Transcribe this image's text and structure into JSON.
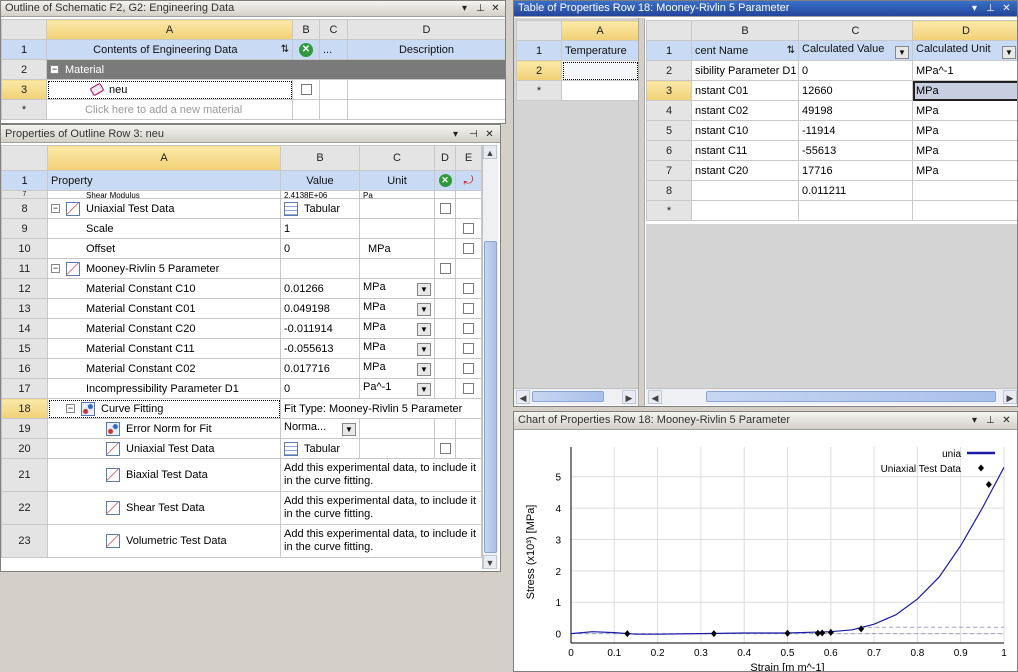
{
  "outline": {
    "title": "Outline of Schematic F2, G2: Engineering Data",
    "cols": [
      "A",
      "B",
      "C",
      "D"
    ],
    "hdr": {
      "rn": "1",
      "a": "Contents of Engineering Data",
      "c": "\u0015...",
      "d": "Description"
    },
    "rows": [
      {
        "rn": "2",
        "a": "Material"
      },
      {
        "rn": "3",
        "a": "neu"
      },
      {
        "rn": "*",
        "a": "Click here to add a new material"
      }
    ]
  },
  "props": {
    "title": "Properties of Outline Row 3: neu",
    "cols": [
      "A",
      "B",
      "C",
      "D",
      "E"
    ],
    "hdr": {
      "rn": "1",
      "a": "Property",
      "b": "Value",
      "c": "Unit"
    },
    "rows": [
      {
        "rn": "7",
        "a": "Shear Modulus",
        "b": "2.4138E+06",
        "c": "Pa"
      },
      {
        "rn": "8",
        "a": "Uniaxial Test Data",
        "b": "Tabular",
        "c": ""
      },
      {
        "rn": "9",
        "a": "Scale",
        "b": "1",
        "c": ""
      },
      {
        "rn": "10",
        "a": "Offset",
        "b": "0",
        "c": "MPa"
      },
      {
        "rn": "11",
        "a": "Mooney-Rivlin 5 Parameter",
        "b": "",
        "c": ""
      },
      {
        "rn": "12",
        "a": "Material Constant C10",
        "b": "0.01266",
        "c": "MPa"
      },
      {
        "rn": "13",
        "a": "Material Constant C01",
        "b": "0.049198",
        "c": "MPa"
      },
      {
        "rn": "14",
        "a": "Material Constant C20",
        "b": "-0.011914",
        "c": "MPa"
      },
      {
        "rn": "15",
        "a": "Material Constant C11",
        "b": "-0.055613",
        "c": "MPa"
      },
      {
        "rn": "16",
        "a": "Material Constant C02",
        "b": "0.017716",
        "c": "MPa"
      },
      {
        "rn": "17",
        "a": "Incompressibility Parameter D1",
        "b": "0",
        "c": "Pa^-1"
      },
      {
        "rn": "18",
        "a": "Curve Fitting",
        "b": "Fit Type: Mooney-Rivlin 5 Parameter",
        "c": ""
      },
      {
        "rn": "19",
        "a": "Error Norm for Fit",
        "b": "Norma...",
        "c": ""
      },
      {
        "rn": "20",
        "a": "Uniaxial Test Data",
        "b": "Tabular",
        "c": ""
      },
      {
        "rn": "21",
        "a": "Biaxial Test Data",
        "b": "Add this experimental data, to include it in the curve fitting.",
        "c": ""
      },
      {
        "rn": "22",
        "a": "Shear Test Data",
        "b": "Add this experimental data, to include it in the curve fitting.",
        "c": ""
      },
      {
        "rn": "23",
        "a": "Volumetric Test Data",
        "b": "Add this experimental data, to include it in the curve fitting.",
        "c": ""
      }
    ]
  },
  "table": {
    "title": "Table of Properties Row 18: Mooney-Rivlin 5 Parameter",
    "left_cols": [
      "A"
    ],
    "left_hdr": {
      "rn": "1",
      "a": "Temperature"
    },
    "left_rows": [
      "2",
      "*"
    ],
    "cols": [
      "B",
      "C",
      "D"
    ],
    "hdr": {
      "rn": "1",
      "b": "cent Name",
      "c": "Calculated Value",
      "d": "Calculated Unit"
    },
    "rows": [
      {
        "rn": "2",
        "b": "sibility Parameter D1",
        "c": "0",
        "d": "MPa^-1"
      },
      {
        "rn": "3",
        "b": "nstant C01",
        "c": "12660",
        "d": "MPa"
      },
      {
        "rn": "4",
        "b": "nstant C02",
        "c": "49198",
        "d": "MPa"
      },
      {
        "rn": "5",
        "b": "nstant C10",
        "c": "-11914",
        "d": "MPa"
      },
      {
        "rn": "6",
        "b": "nstant C11",
        "c": "-55613",
        "d": "MPa"
      },
      {
        "rn": "7",
        "b": "nstant C20",
        "c": "17716",
        "d": "MPa"
      },
      {
        "rn": "8",
        "b": "",
        "c": "0.011211",
        "d": ""
      },
      {
        "rn": "*",
        "b": "",
        "c": "",
        "d": ""
      }
    ]
  },
  "chart": {
    "title": "Chart of Properties Row 18: Mooney-Rivlin 5 Parameter"
  },
  "chart_data": {
    "type": "scatter",
    "xlabel": "Strain  [m m^-1]",
    "ylabel": "Stress  (x10³)  [MPa]",
    "xlim": [
      0,
      1
    ],
    "ylim": [
      -0.3,
      5.5
    ],
    "xticks": [
      "0",
      "0.1",
      "0.2",
      "0.3",
      "0.4",
      "0.5",
      "0.6",
      "0.7",
      "0.8",
      "0.9",
      "1"
    ],
    "yticks": [
      "0",
      "1",
      "2",
      "3",
      "4",
      "5"
    ],
    "legend": "top-right",
    "series": [
      {
        "name": "unia",
        "kind": "line",
        "color": "#1a1aa8",
        "x": [
          0,
          0.05,
          0.1,
          0.15,
          0.2,
          0.3,
          0.4,
          0.5,
          0.55,
          0.6,
          0.65,
          0.7,
          0.75,
          0.8,
          0.85,
          0.9,
          0.95,
          1.0
        ],
        "y": [
          0,
          0.06,
          0.03,
          -0.02,
          -0.02,
          0,
          0.02,
          0.02,
          0.04,
          0.06,
          0.12,
          0.3,
          0.6,
          1.1,
          1.8,
          2.8,
          4.0,
          5.3
        ]
      },
      {
        "name": "Uniaxial Test Data",
        "kind": "points",
        "color": "#000",
        "x": [
          0.13,
          0.33,
          0.5,
          0.57,
          0.58,
          0.6,
          0.67,
          0.965
        ],
        "y": [
          0,
          0,
          0.01,
          0.01,
          0.02,
          0.04,
          0.15,
          4.75
        ]
      }
    ],
    "ref_line": 0.2
  }
}
